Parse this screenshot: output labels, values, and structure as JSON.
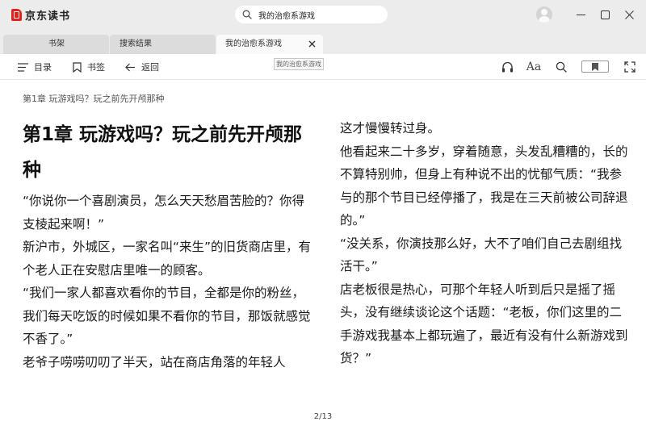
{
  "app": {
    "logo_text": "京东读书",
    "brand_color": "#e2231a"
  },
  "search": {
    "value": "我的治愈系游戏",
    "icon": "search-icon"
  },
  "window_controls": [
    "avatar",
    "minimize-icon",
    "maximize-icon",
    "close-icon"
  ],
  "tabs": [
    {
      "label": "书架",
      "active": false
    },
    {
      "label": "搜索结果",
      "active": false
    },
    {
      "label": "我的治愈系游戏",
      "active": true
    }
  ],
  "toolbar": {
    "toc_label": "目录",
    "bookmark_label": "书签",
    "back_label": "返回",
    "toast_text": "我的治愈系游戏",
    "font_label": "Aa",
    "icons": [
      "audio-icon",
      "font-size-icon",
      "search-icon",
      "bookmark-toggle-icon",
      "fullscreen-icon"
    ]
  },
  "reader": {
    "breadcrumb": "第1章 玩游戏吗？玩之前先开颅那种",
    "chapter_title": "第1章  玩游戏吗？玩之前先开颅那种",
    "left_paragraphs": [
      "“你说你一个喜剧演员，怎么天天愁眉苦脸的？你得支棱起来啊！”",
      "新沪市，外城区，一家名叫“来生”的旧货商店里，有个老人正在安慰店里唯一的顾客。",
      "“我们一家人都喜欢看你的节目，全都是你的粉丝，我们每天吃饭的时候如果不看你的节目，那饭就感觉不香了。”",
      "老爷子唠唠叨叨了半天，站在商店角落的年轻人"
    ],
    "right_paragraphs": [
      "这才慢慢转过身。",
      "他看起来二十多岁，穿着随意，头发乱糟糟的，长的不算特别帅，但身上有种说不出的忧郁气质：“我参与的那个节目已经停播了，我是在三天前被公司辞退的。”",
      "“没关系，你演技那么好，大不了咱们自己去剧组找活干。”",
      "店老板很是热心，可那个年轻人听到后只是摇了摇头，没有继续谈论这个话题：“老板，你们这里的二手游戏我基本上都玩遍了，最近有没有什么新游戏到货？”"
    ],
    "page_indicator": "2/13"
  }
}
